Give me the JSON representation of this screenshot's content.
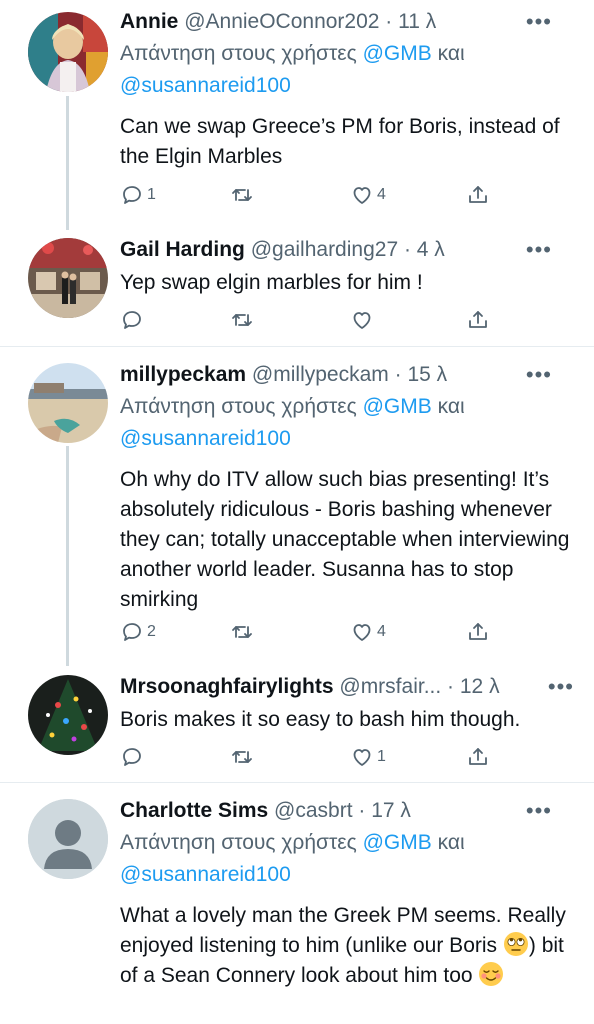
{
  "tweets": [
    {
      "name": "Annie",
      "handle": "@AnnieOConnor202",
      "time": "11 λ",
      "reply_prefix": "Απάντηση στους χρήστες ",
      "reply_mention1": "@GMB",
      "reply_and": " και",
      "reply_mention2": "@susannareid100",
      "text": "Can we swap Greece’s PM for Boris, instead of the Elgin Marbles",
      "replies": "1",
      "retweets": "",
      "likes": "4"
    },
    {
      "name": "Gail Harding",
      "handle": "@gailharding27",
      "time": "4 λ",
      "text": "Yep swap elgin marbles for him !",
      "replies": "",
      "retweets": "",
      "likes": ""
    },
    {
      "name": "millypeckam",
      "handle": "@millypeckam",
      "time": "15 λ",
      "reply_prefix": "Απάντηση στους χρήστες ",
      "reply_mention1": "@GMB",
      "reply_and": " και",
      "reply_mention2": "@susannareid100",
      "text": "Oh why do ITV allow such bias presenting! It’s absolutely ridiculous - Boris bashing whenever they can; totally unacceptable when interviewing another world leader. Susanna has to stop smirking",
      "replies": "2",
      "retweets": "",
      "likes": "4"
    },
    {
      "name": "Mrsoonaghfairylights",
      "handle": "@mrsfair...",
      "time": "12 λ",
      "text": "Boris makes it so easy to bash him though.",
      "replies": "",
      "retweets": "",
      "likes": "1"
    },
    {
      "name": "Charlotte Sims",
      "handle": "@casbrt",
      "time": "17 λ",
      "reply_prefix": "Απάντηση στους χρήστες ",
      "reply_mention1": "@GMB",
      "reply_and": " και",
      "reply_mention2": "@susannareid100",
      "text_part1": "What a lovely man the Greek PM seems. Really enjoyed listening to him (unlike our Boris ",
      "text_part2": ") bit of a Sean Connery look about him too ",
      "emoji1": "rolling-eyes-emoji",
      "emoji2": "relieved-smile-emoji"
    }
  ],
  "icons": {
    "reply": "reply-icon",
    "retweet": "retweet-icon",
    "like": "like-icon",
    "share": "share-icon",
    "more": "more-icon"
  },
  "colors": {
    "link": "#1d9bf0",
    "secondary": "#536471",
    "divider": "#e6ecf0",
    "thread_line": "#cfd9de"
  },
  "more_label": "•••",
  "dot": " · "
}
